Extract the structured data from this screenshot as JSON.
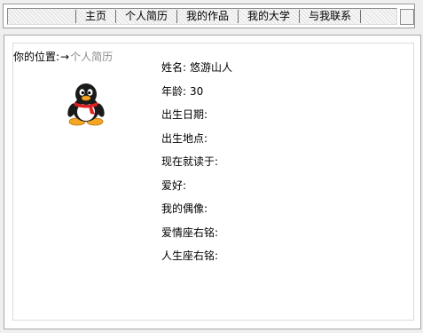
{
  "nav": {
    "items": [
      {
        "label": "主页"
      },
      {
        "label": "个人简历"
      },
      {
        "label": "我的作品"
      },
      {
        "label": "我的大学"
      },
      {
        "label": "与我联系"
      }
    ]
  },
  "breadcrumb": {
    "prefix": "你的位置:",
    "arrow": "→",
    "current": "个人简历"
  },
  "avatar": {
    "icon": "qq-penguin-icon"
  },
  "profile": {
    "name": {
      "label": "姓名:",
      "value": "悠游山人"
    },
    "age": {
      "label": "年龄:",
      "value": "30"
    },
    "birth_date": {
      "label": "出生日期:",
      "value": ""
    },
    "birth_place": {
      "label": "出生地点:",
      "value": ""
    },
    "school": {
      "label": "现在就读于:",
      "value": ""
    },
    "hobby": {
      "label": "爱好:",
      "value": ""
    },
    "idol": {
      "label": "我的偶像:",
      "value": ""
    },
    "love_motto": {
      "label": "爱情座右铭:",
      "value": ""
    },
    "life_motto": {
      "label": "人生座右铭:",
      "value": ""
    }
  }
}
